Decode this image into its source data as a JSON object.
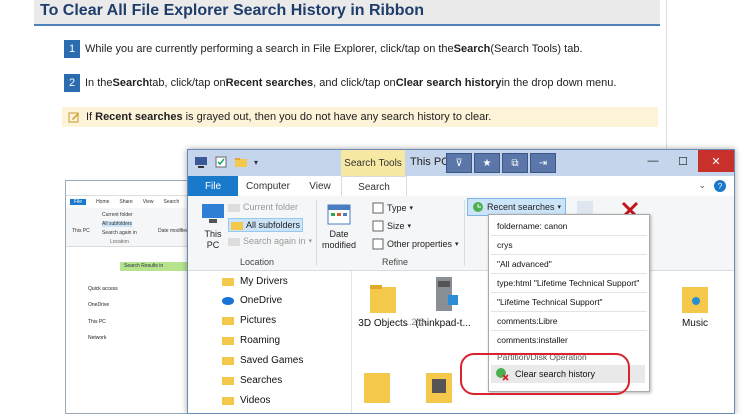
{
  "heading": "To Clear All File Explorer Search History in Ribbon",
  "steps": [
    {
      "num": "1",
      "pre": "While you are currently performing a search in File Explorer, click/tap on the ",
      "b1": "Search",
      "mid": " (Search Tools) tab.",
      "b2": "",
      "post": ""
    },
    {
      "num": "2",
      "pre": "In the ",
      "b1": "Search",
      "mid": " tab, click/tap on ",
      "b2": "Recent searches",
      "mid2": ", and click/tap on ",
      "b3": "Clear search history",
      "post": " in the drop down menu."
    }
  ],
  "note": {
    "pre": "If ",
    "bold": "Recent searches",
    "post": " is grayed out, then you do not have any search history to clear."
  },
  "small_window": {
    "tabs": [
      "File",
      "Home",
      "Share",
      "View",
      "Search"
    ],
    "ribbon_labels": [
      "This PC",
      "Current folder",
      "All subfolders",
      "Search again in",
      "Location",
      "Date modified"
    ],
    "address": "Search Results in",
    "nav": [
      "Quick access",
      "OneDrive",
      "This PC",
      "Network"
    ]
  },
  "window": {
    "context_group": "Search Tools",
    "title": "This PC",
    "tabs": {
      "file": "File",
      "computer": "Computer",
      "view": "View",
      "search": "Search"
    },
    "ribbon": {
      "this_pc": "This\nPC",
      "current_folder": "Current folder",
      "all_subfolders": "All subfolders",
      "search_again": "Search again in",
      "location_label": "Location",
      "date_modified": "Date\nmodified",
      "type": "Type",
      "size": "Size",
      "other_properties": "Other properties",
      "refine_label": "Refine",
      "recent_searches": "Recent searches"
    },
    "nav": [
      "My Drivers",
      "OneDrive",
      "Pictures",
      "Roaming",
      "Saved Games",
      "Searches",
      "Videos"
    ],
    "files": [
      "3D Objects",
      "(thinkpad-t...",
      "ds",
      "Music"
    ],
    "file_partial": "...2@."
  },
  "menu": {
    "items": [
      "foldername: canon",
      "crys",
      "\"All advanced\"",
      "type:html \"Lifetime Technical Support\"",
      "\"Lifetime Technical Support\"",
      "comments:Libre",
      "comments:installer",
      "Partition/Disk Operation"
    ],
    "clear": "Clear search history"
  },
  "colors": {
    "accent": "#1979ca",
    "heading_rule": "#4f81bd",
    "note_bg": "#fdf3d8",
    "highlight_ring": "#d9232d"
  }
}
